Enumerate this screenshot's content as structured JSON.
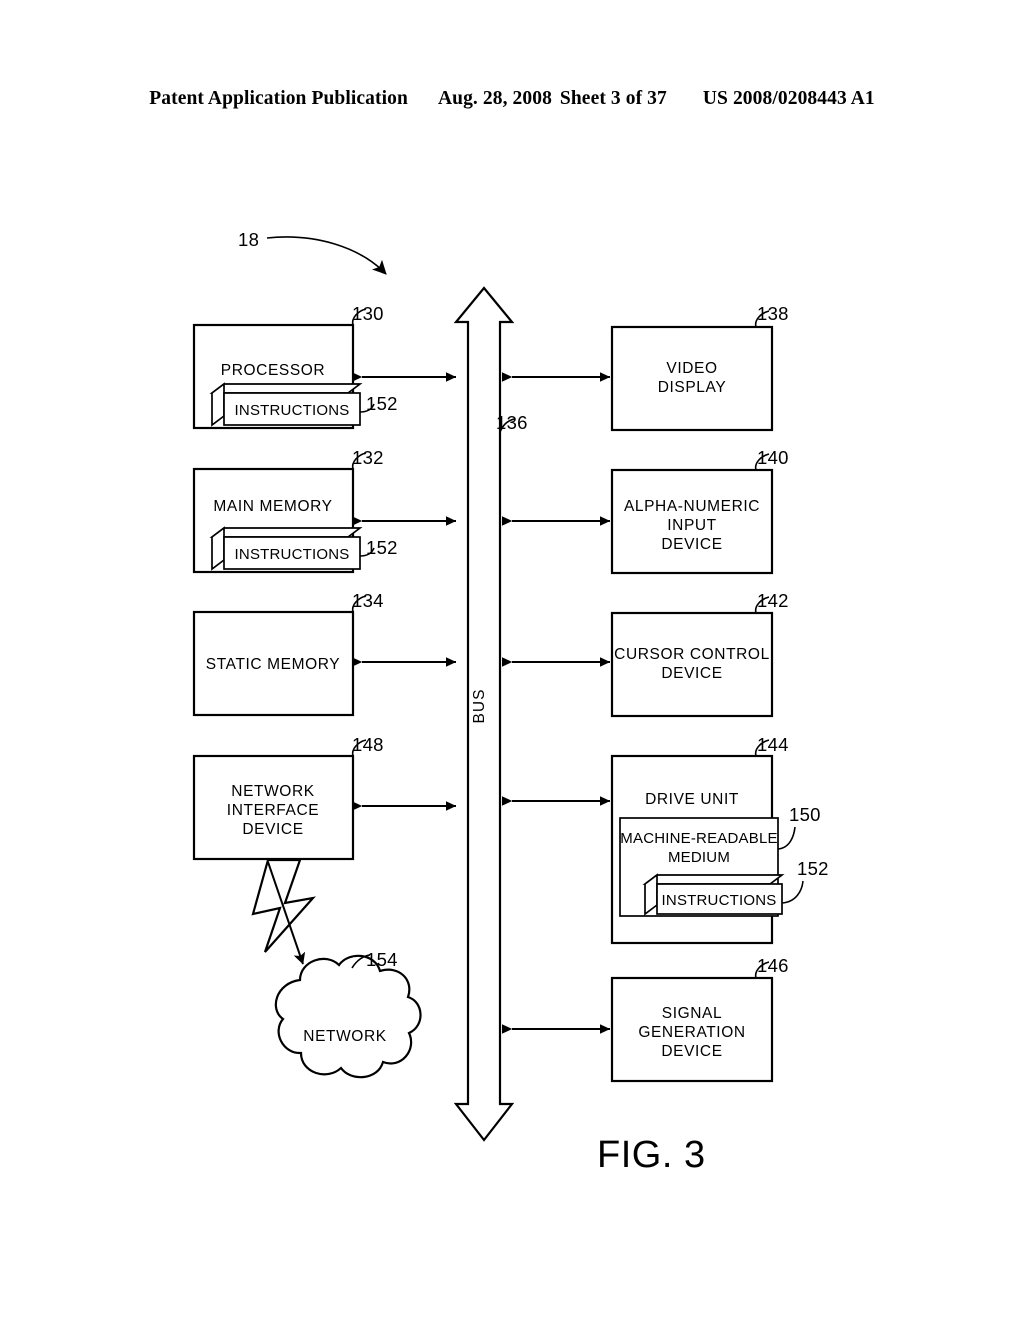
{
  "header": {
    "publication": "Patent Application Publication",
    "date": "Aug. 28, 2008",
    "sheet": "Sheet 3 of 37",
    "patent_number": "US 2008/0208443 A1"
  },
  "figure": {
    "caption": "FIG. 3",
    "system_ref": "18",
    "bus": {
      "label": "BUS",
      "ref": "136"
    },
    "left_column": [
      {
        "id": "processor",
        "label": "PROCESSOR",
        "ref": "130",
        "inner": {
          "label": "INSTRUCTIONS",
          "ref": "152"
        }
      },
      {
        "id": "main-memory",
        "label": "MAIN MEMORY",
        "ref": "132",
        "inner": {
          "label": "INSTRUCTIONS",
          "ref": "152"
        }
      },
      {
        "id": "static-memory",
        "label": "STATIC MEMORY",
        "ref": "134",
        "inner": null
      },
      {
        "id": "network-interface-device",
        "label_lines": [
          "NETWORK",
          "INTERFACE",
          "DEVICE"
        ],
        "ref": "148",
        "inner": null
      }
    ],
    "right_column": [
      {
        "id": "video-display",
        "label_lines": [
          "VIDEO",
          "DISPLAY"
        ],
        "ref": "138"
      },
      {
        "id": "alpha-numeric-input-device",
        "label_lines": [
          "ALPHA-NUMERIC",
          "INPUT",
          "DEVICE"
        ],
        "ref": "140"
      },
      {
        "id": "cursor-control-device",
        "label_lines": [
          "CURSOR CONTROL",
          "DEVICE"
        ],
        "ref": "142"
      },
      {
        "id": "drive-unit",
        "label": "DRIVE UNIT",
        "ref": "144",
        "inner": {
          "label_lines": [
            "MACHINE-READABLE",
            "MEDIUM"
          ],
          "ref": "150",
          "inner": {
            "label": "INSTRUCTIONS",
            "ref": "152"
          }
        }
      },
      {
        "id": "signal-generation-device",
        "label_lines": [
          "SIGNAL",
          "GENERATION",
          "DEVICE"
        ],
        "ref": "146"
      }
    ],
    "network_cloud": {
      "label": "NETWORK",
      "ref": "154"
    }
  },
  "colors": {
    "ink": "#000000",
    "paper": "#ffffff"
  }
}
